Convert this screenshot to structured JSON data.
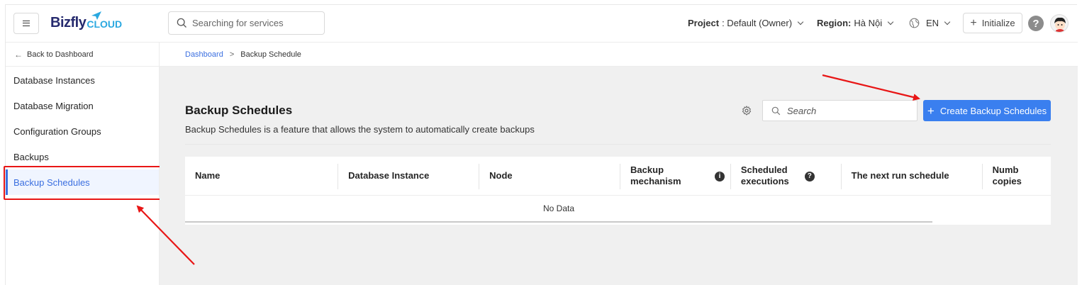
{
  "header": {
    "logo_main": "Bizfly",
    "logo_sub": "CLOUD",
    "search_placeholder": "Searching for services",
    "project_label": "Project",
    "project_value": ": Default (Owner)",
    "region_label": "Region:",
    "region_value": "Hà Nội",
    "language": "EN",
    "initialize_label": "Initialize",
    "help_glyph": "?"
  },
  "sidebar": {
    "back_label": "Back to Dashboard",
    "items": [
      {
        "label": "Database Instances"
      },
      {
        "label": "Database Migration"
      },
      {
        "label": "Configuration Groups"
      },
      {
        "label": "Backups"
      },
      {
        "label": "Backup Schedules",
        "active": true
      }
    ]
  },
  "breadcrumb": {
    "root": "Dashboard",
    "separator": ">",
    "current": "Backup Schedule"
  },
  "page": {
    "title": "Backup Schedules",
    "description": "Backup Schedules is a feature that allows the system to automatically create backups",
    "search_placeholder": "Search",
    "create_label": "Create Backup Schedules"
  },
  "table": {
    "columns": [
      {
        "line1": "Name",
        "line2": ""
      },
      {
        "line1": "Database Instance",
        "line2": ""
      },
      {
        "line1": "Node",
        "line2": ""
      },
      {
        "line1": "Backup",
        "line2": "mechanism",
        "info": "i"
      },
      {
        "line1": "Scheduled",
        "line2": "executions",
        "info": "?"
      },
      {
        "line1": "The next run schedule",
        "line2": ""
      },
      {
        "line1": "Numb",
        "line2": "copies"
      }
    ],
    "empty_text": "No Data"
  },
  "colors": {
    "accent": "#3a7fef",
    "annotation": "#e81616",
    "active_bg": "#f0f5ff"
  }
}
